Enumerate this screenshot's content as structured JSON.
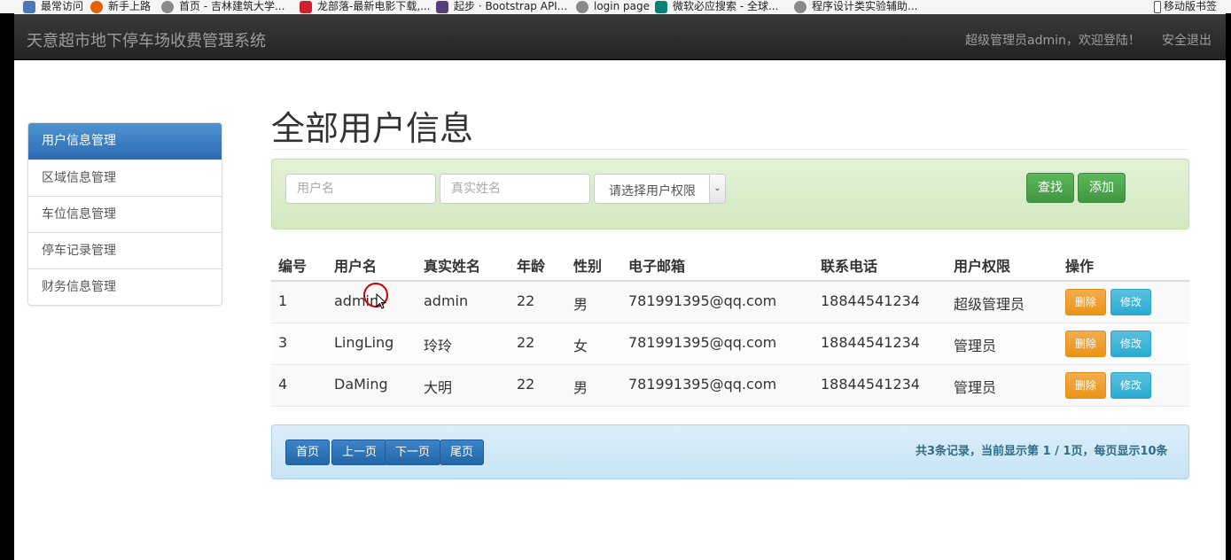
{
  "bookmarks": [
    {
      "label": "最常访问",
      "icon": "bookmark-icon",
      "color": "#4a78b8"
    },
    {
      "label": "新手上路",
      "icon": "firefox-icon",
      "color": "#e66000"
    },
    {
      "label": "首页 - 吉林建筑大学...",
      "icon": "globe-icon",
      "color": "#8a8a8a"
    },
    {
      "label": "龙部落-最新电影下载,...",
      "icon": "dragon-icon",
      "color": "#d0202a"
    },
    {
      "label": "起步 · Bootstrap API...",
      "icon": "bootstrap-icon",
      "color": "#563d7c"
    },
    {
      "label": "login page",
      "icon": "globe-icon",
      "color": "#8a8a8a"
    },
    {
      "label": "微软必应搜索 - 全球...",
      "icon": "bing-icon",
      "color": "#008373"
    },
    {
      "label": "程序设计类实验辅助...",
      "icon": "globe-icon",
      "color": "#8a8a8a"
    }
  ],
  "mobile_bookmarks": {
    "label": "移动版书签",
    "icon": "mobile-icon"
  },
  "navbar": {
    "brand": "天意超市地下停车场收费管理系统",
    "welcome": "超级管理员admin，欢迎登陆！",
    "logout": "安全退出"
  },
  "sidebar": {
    "items": [
      {
        "label": "用户信息管理",
        "active": true
      },
      {
        "label": "区域信息管理",
        "active": false
      },
      {
        "label": "车位信息管理",
        "active": false
      },
      {
        "label": "停车记录管理",
        "active": false
      },
      {
        "label": "财务信息管理",
        "active": false
      }
    ]
  },
  "page": {
    "title": "全部用户信息"
  },
  "search": {
    "username_placeholder": "用户名",
    "realname_placeholder": "真实姓名",
    "role_select": "请选择用户权限",
    "find_button": "查找",
    "add_button": "添加"
  },
  "table": {
    "headers": [
      "编号",
      "用户名",
      "真实姓名",
      "年龄",
      "性别",
      "电子邮箱",
      "联系电话",
      "用户权限",
      "操作"
    ],
    "rows": [
      {
        "id": "1",
        "username": "admin",
        "realname": "admin",
        "age": "22",
        "gender": "男",
        "email": "781991395@qq.com",
        "phone": "18844541234",
        "role": "超级管理员",
        "delete": "删除",
        "edit": "修改"
      },
      {
        "id": "3",
        "username": "LingLing",
        "realname": "玲玲",
        "age": "22",
        "gender": "女",
        "email": "781991395@qq.com",
        "phone": "18844541234",
        "role": "管理员",
        "delete": "删除",
        "edit": "修改"
      },
      {
        "id": "4",
        "username": "DaMing",
        "realname": "大明",
        "age": "22",
        "gender": "男",
        "email": "781991395@qq.com",
        "phone": "18844541234",
        "role": "管理员",
        "delete": "删除",
        "edit": "修改"
      }
    ]
  },
  "pager": {
    "first": "首页",
    "prev": "上一页",
    "next": "下一页",
    "last": "尾页",
    "info": "共3条记录，当前显示第 1 / 1页，每页显示10条"
  },
  "colors": {
    "navbar": "#222222",
    "sidebar_active": "#337ab7",
    "success": "#5cb85c",
    "warning": "#f0ad4e",
    "info": "#5bc0de",
    "pager_button": "#2a6ead"
  }
}
